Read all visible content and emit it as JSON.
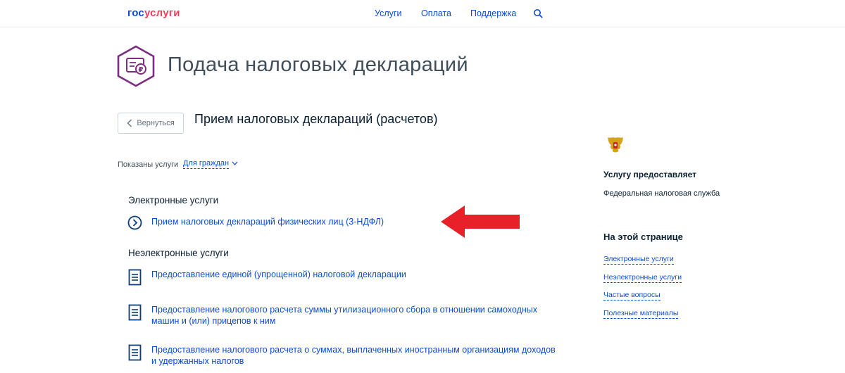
{
  "header": {
    "logo_part1": "гос",
    "logo_part2": "услуги",
    "nav": [
      "Услуги",
      "Оплата",
      "Поддержка"
    ],
    "search_icon": "search-icon"
  },
  "page": {
    "title": "Подача налоговых деклараций",
    "back_label": "Вернуться",
    "subtitle": "Прием налоговых деклараций (расчетов)"
  },
  "filter": {
    "label": "Показаны услуги",
    "value": "Для граждан"
  },
  "sections": {
    "electronic": {
      "heading": "Электронные услуги",
      "items": [
        "Прием налоговых деклараций физических лиц (3-НДФЛ)"
      ]
    },
    "non_electronic": {
      "heading": "Неэлектронные услуги",
      "items": [
        "Предоставление единой (упрощенной) налоговой декларации",
        "Предоставление налогового расчета суммы утилизационного сбора в отношении самоходных машин и (или) прицепов к ним",
        "Предоставление налогового расчета о суммах, выплаченных иностранным организациям доходов и удержанных налогов"
      ]
    }
  },
  "sidebar": {
    "provider_heading": "Услугу предоставляет",
    "provider_value": "Федеральная налоговая служба",
    "onpage_heading": "На этой странице",
    "onpage_links": [
      "Электронные услуги",
      "Неэлектронные услуги",
      "Частые вопросы",
      "Полезные материалы"
    ]
  },
  "colors": {
    "link": "#0d4cd3",
    "logo_red": "#ee3f58",
    "emblem_purple": "#7b2d80",
    "arrow_red": "#e8202a"
  }
}
